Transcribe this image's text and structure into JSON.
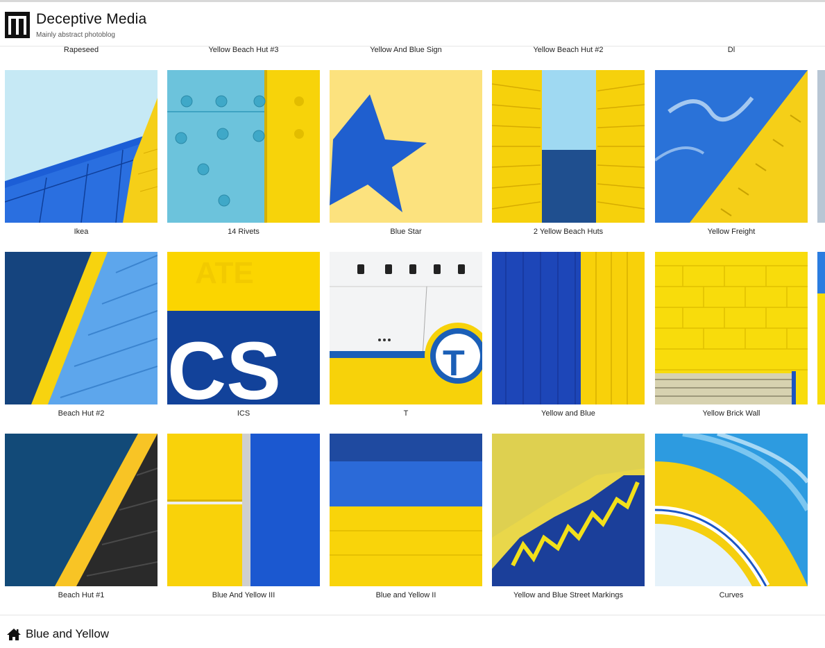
{
  "site": {
    "title": "Deceptive Media",
    "tagline": "Mainly abstract photoblog",
    "logo_icon": "deceptive-media-logo"
  },
  "top_row_labels": [
    "Rapeseed",
    "Yellow Beach Hut #3",
    "Yellow And Blue Sign",
    "Yellow Beach Hut #2",
    "Dl"
  ],
  "gallery": {
    "rows": [
      [
        "Ikea",
        "14 Rivets",
        "Blue Star",
        "2 Yellow Beach Huts",
        "Yellow Freight"
      ],
      [
        "Beach Hut #2",
        "ICS",
        "T",
        "Yellow and Blue",
        "Yellow Brick Wall"
      ],
      [
        "Beach Hut #1",
        "Blue And Yellow III",
        "Blue and Yellow II",
        "Yellow and Blue Street Markings",
        "Curves"
      ]
    ],
    "sign_text": {
      "ics": "CS",
      "t": "T"
    }
  },
  "footer": {
    "home_icon": "home-icon",
    "category": "Blue and Yellow"
  },
  "colors": {
    "yellow": "#fcd500",
    "blue": "#1a5fd0",
    "navy": "#123f8f",
    "sky": "#bfe6f2"
  }
}
